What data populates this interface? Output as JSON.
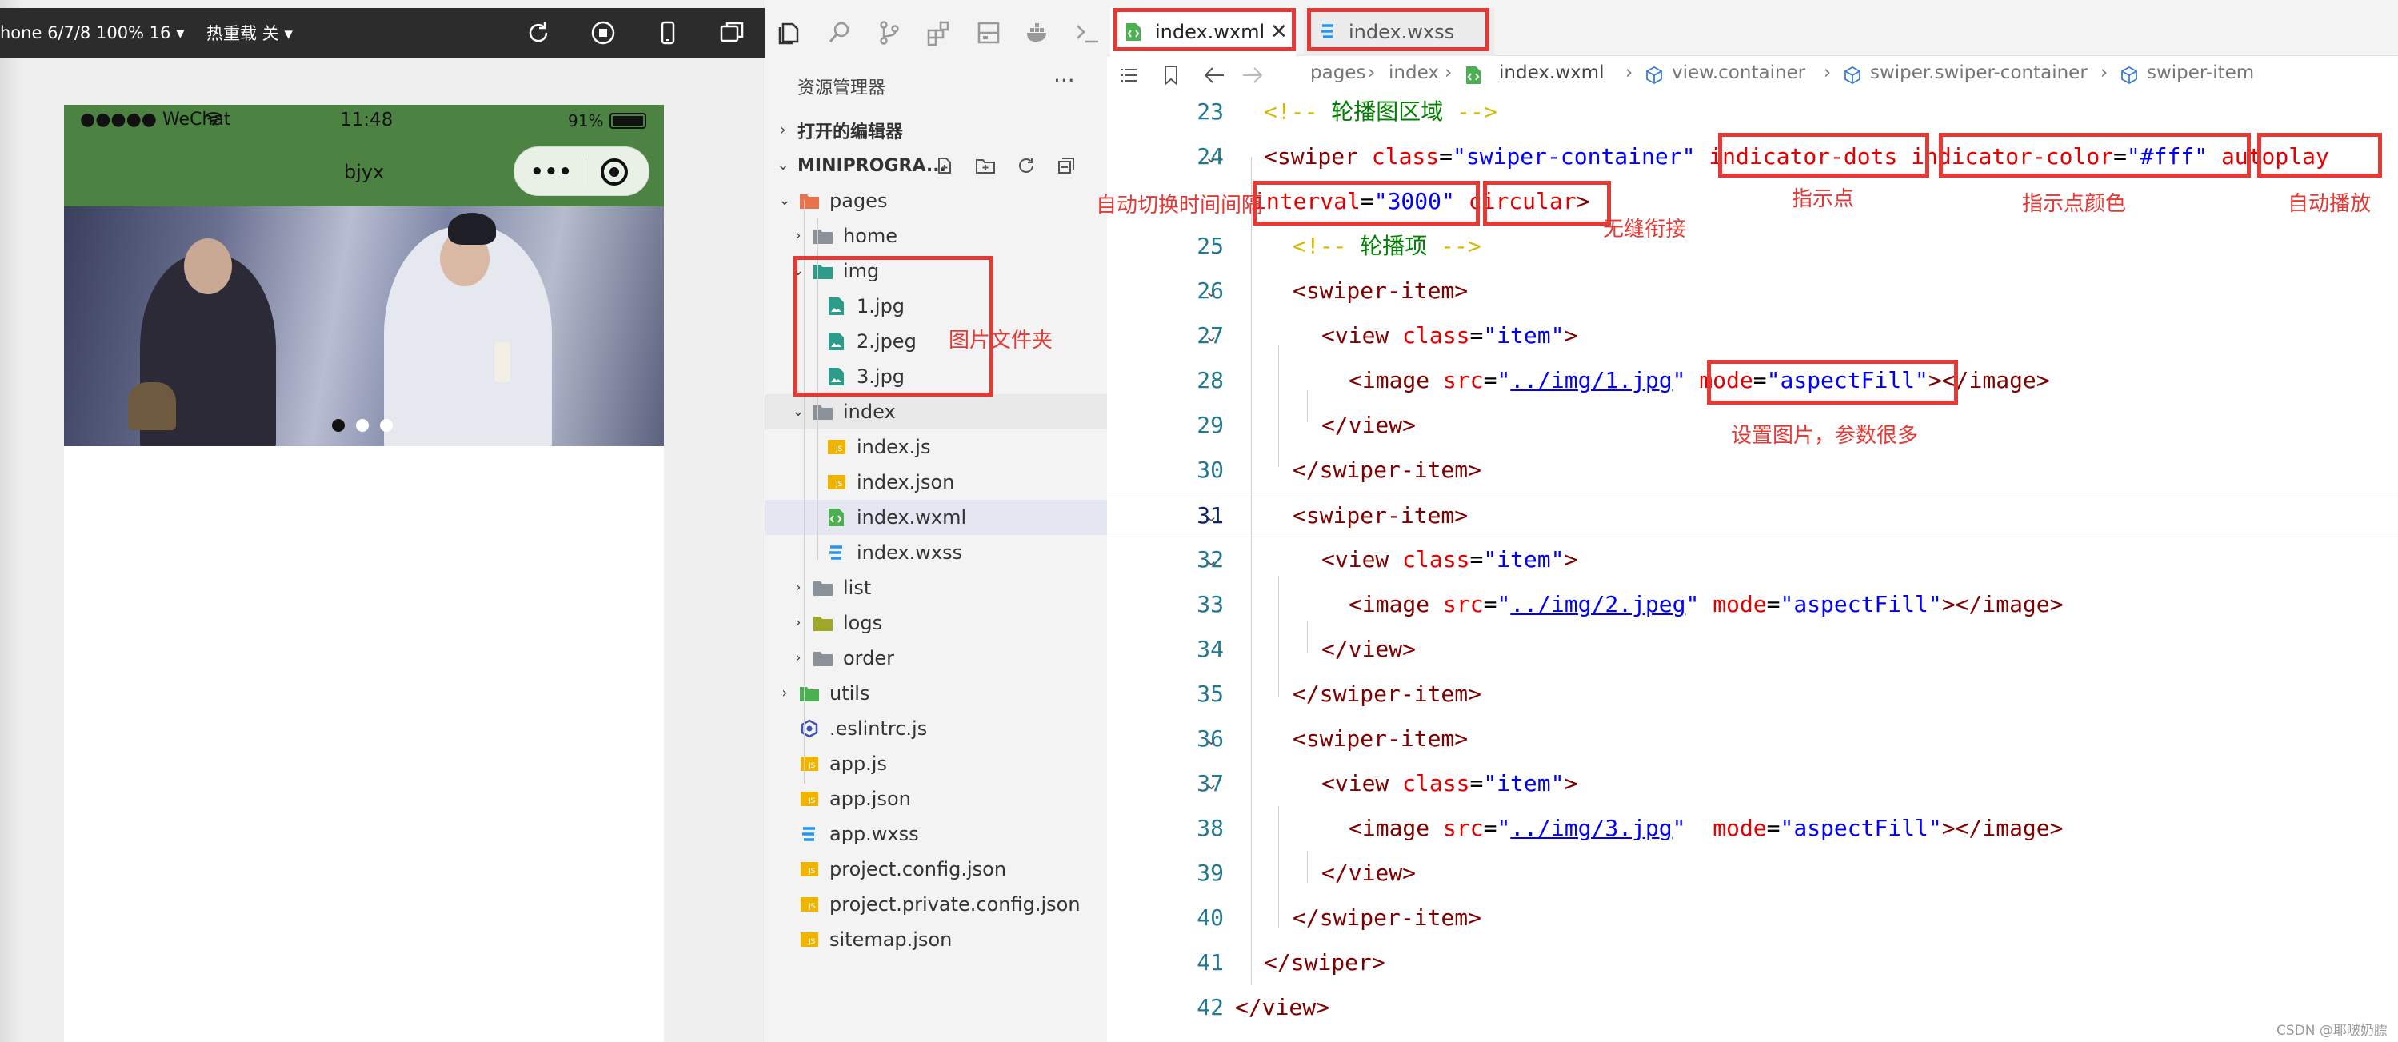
{
  "simulator": {
    "toolbar": {
      "device": "hone 6/7/8 100% 16 ▾",
      "hot_reload": "热重载 关 ▾"
    },
    "statusbar": {
      "carrier": "●●●●● WeChat",
      "time": "11:48",
      "battery": "91%"
    },
    "nav_title": "bjyx",
    "capsule": {
      "menu": "•••"
    },
    "swiper": {
      "dot_count": 3,
      "active_index": 0
    }
  },
  "explorer": {
    "title": "资源管理器",
    "more": "···",
    "open_editors": "打开的编辑器",
    "project": "MINIPROGRA...",
    "items": [
      {
        "label": "pages",
        "icon": "folder-pages-icon",
        "chevron": "open",
        "color": "#e8734a"
      },
      {
        "label": "home",
        "icon": "folder-icon",
        "chevron": "closed",
        "color": "#8b9199"
      },
      {
        "label": "img",
        "icon": "folder-img-icon",
        "chevron": "open",
        "color": "#2e9c8a"
      },
      {
        "label": "1.jpg",
        "icon": "image-file-icon",
        "color": "#2e9c8a"
      },
      {
        "label": "2.jpeg",
        "icon": "image-file-icon",
        "color": "#2e9c8a"
      },
      {
        "label": "3.jpg",
        "icon": "image-file-icon",
        "color": "#2e9c8a"
      },
      {
        "label": "index",
        "icon": "folder-open-icon",
        "chevron": "open",
        "color": "#8b9199"
      },
      {
        "label": "index.js",
        "icon": "js-file-icon",
        "color": "#f0b400"
      },
      {
        "label": "index.json",
        "icon": "json-file-icon",
        "color": "#f0b400"
      },
      {
        "label": "index.wxml",
        "icon": "wxml-file-icon",
        "color": "#4caf50"
      },
      {
        "label": "index.wxss",
        "icon": "css-file-icon",
        "color": "#2196f3"
      },
      {
        "label": "list",
        "icon": "folder-icon",
        "chevron": "closed",
        "color": "#8b9199"
      },
      {
        "label": "logs",
        "icon": "folder-logs-icon",
        "chevron": "closed",
        "color": "#a0a82a"
      },
      {
        "label": "order",
        "icon": "folder-icon",
        "chevron": "closed",
        "color": "#8b9199"
      },
      {
        "label": "utils",
        "icon": "folder-utils-icon",
        "chevron": "closed",
        "color": "#4caf50"
      },
      {
        "label": ".eslintrc.js",
        "icon": "eslint-file-icon",
        "color": "#3f51b5"
      },
      {
        "label": "app.js",
        "icon": "js-file-icon",
        "color": "#f0b400"
      },
      {
        "label": "app.json",
        "icon": "json-file-icon",
        "color": "#f0b400"
      },
      {
        "label": "app.wxss",
        "icon": "css-file-icon",
        "color": "#2196f3"
      },
      {
        "label": "project.config.json",
        "icon": "json-file-icon",
        "color": "#f0b400"
      },
      {
        "label": "project.private.config.json",
        "icon": "json-file-icon",
        "color": "#f0b400"
      },
      {
        "label": "sitemap.json",
        "icon": "json-file-icon",
        "color": "#f0b400"
      }
    ]
  },
  "editor": {
    "tabs": [
      {
        "label": "index.wxml",
        "close": "✕"
      },
      {
        "label": "index.wxss"
      }
    ],
    "breadcrumb": [
      "pages",
      "index",
      "index.wxml",
      "view.container",
      "swiper.swiper-container",
      "swiper-item"
    ],
    "lines": [
      {
        "n": "23",
        "tokens": [
          [
            "bk",
            "<!-- "
          ],
          [
            "cm",
            "轮播图区域"
          ],
          [
            "bk",
            " -->"
          ]
        ]
      },
      {
        "n": "24",
        "fold": true,
        "tokens": [
          [
            "tg",
            "<swiper "
          ],
          [
            "at",
            "class"
          ],
          [
            "pl",
            "="
          ],
          [
            "av",
            "\"swiper-container\""
          ],
          [
            "pl",
            " "
          ],
          [
            "at",
            "indicator-dots"
          ],
          [
            "pl",
            " "
          ],
          [
            "at",
            "indicator-color"
          ],
          [
            "pl",
            "="
          ],
          [
            "av",
            "\"#fff\""
          ],
          [
            "pl",
            " "
          ],
          [
            "at",
            "autoplay"
          ]
        ]
      },
      {
        "n": "",
        "tokens": [
          [
            "at",
            "interval"
          ],
          [
            "pl",
            "="
          ],
          [
            "av",
            "\"3000\""
          ],
          [
            "pl",
            " "
          ],
          [
            "at",
            "circular"
          ],
          [
            "tg",
            ">"
          ]
        ]
      },
      {
        "n": "25",
        "tokens": [
          [
            "bk",
            "<!-- "
          ],
          [
            "cm",
            "轮播项"
          ],
          [
            "bk",
            " -->"
          ]
        ]
      },
      {
        "n": "26",
        "fold": true,
        "tokens": [
          [
            "tg",
            "<swiper-item>"
          ]
        ]
      },
      {
        "n": "27",
        "fold": true,
        "tokens": [
          [
            "tg",
            "<view "
          ],
          [
            "at",
            "class"
          ],
          [
            "pl",
            "="
          ],
          [
            "av",
            "\"item\""
          ],
          [
            "tg",
            ">"
          ]
        ]
      },
      {
        "n": "28",
        "tokens": [
          [
            "tg",
            "<image "
          ],
          [
            "at",
            "src"
          ],
          [
            "pl",
            "="
          ],
          [
            "av",
            "\""
          ],
          [
            "lk",
            "../img/1.jpg"
          ],
          [
            "av",
            "\""
          ],
          [
            "pl",
            " "
          ],
          [
            "at",
            "mode"
          ],
          [
            "pl",
            "="
          ],
          [
            "av",
            "\"aspectFill\""
          ],
          [
            "tg",
            "></image>"
          ]
        ]
      },
      {
        "n": "29",
        "tokens": [
          [
            "tg",
            "</view>"
          ]
        ]
      },
      {
        "n": "30",
        "tokens": [
          [
            "tg",
            "</swiper-item>"
          ]
        ]
      },
      {
        "n": "31",
        "fold": true,
        "active": true,
        "tokens": [
          [
            "tg",
            "<swiper-item>"
          ]
        ]
      },
      {
        "n": "32",
        "fold": true,
        "tokens": [
          [
            "tg",
            "<view "
          ],
          [
            "at",
            "class"
          ],
          [
            "pl",
            "="
          ],
          [
            "av",
            "\"item\""
          ],
          [
            "tg",
            ">"
          ]
        ]
      },
      {
        "n": "33",
        "tokens": [
          [
            "tg",
            "<image "
          ],
          [
            "at",
            "src"
          ],
          [
            "pl",
            "="
          ],
          [
            "av",
            "\""
          ],
          [
            "lk",
            "../img/2.jpeg"
          ],
          [
            "av",
            "\""
          ],
          [
            "pl",
            " "
          ],
          [
            "at",
            "mode"
          ],
          [
            "pl",
            "="
          ],
          [
            "av",
            "\"aspectFill\""
          ],
          [
            "tg",
            "></image>"
          ]
        ]
      },
      {
        "n": "34",
        "tokens": [
          [
            "tg",
            "</view>"
          ]
        ]
      },
      {
        "n": "35",
        "tokens": [
          [
            "tg",
            "</swiper-item>"
          ]
        ]
      },
      {
        "n": "36",
        "fold": true,
        "tokens": [
          [
            "tg",
            "<swiper-item>"
          ]
        ]
      },
      {
        "n": "37",
        "fold": true,
        "tokens": [
          [
            "tg",
            "<view "
          ],
          [
            "at",
            "class"
          ],
          [
            "pl",
            "="
          ],
          [
            "av",
            "\"item\""
          ],
          [
            "tg",
            ">"
          ]
        ]
      },
      {
        "n": "38",
        "tokens": [
          [
            "tg",
            "<image "
          ],
          [
            "at",
            "src"
          ],
          [
            "pl",
            "="
          ],
          [
            "av",
            "\""
          ],
          [
            "lk",
            "../img/3.jpg"
          ],
          [
            "av",
            "\""
          ],
          [
            "pl",
            "  "
          ],
          [
            "at",
            "mode"
          ],
          [
            "pl",
            "="
          ],
          [
            "av",
            "\"aspectFill\""
          ],
          [
            "tg",
            "></image>"
          ]
        ]
      },
      {
        "n": "39",
        "tokens": [
          [
            "tg",
            "</view>"
          ]
        ]
      },
      {
        "n": "40",
        "tokens": [
          [
            "tg",
            "</swiper-item>"
          ]
        ]
      },
      {
        "n": "41",
        "tokens": [
          [
            "tg",
            "</swiper>"
          ]
        ]
      },
      {
        "n": "42",
        "tokens": [
          [
            "tg",
            "</view>"
          ]
        ]
      }
    ]
  },
  "annotations": {
    "img_folder": "图片文件夹",
    "interval": "自动切换时间间隔",
    "circular": "无缝衔接",
    "indicator_dots": "指示点",
    "indicator_color": "指示点颜色",
    "autoplay": "自动播放",
    "mode": "设置图片，参数很多"
  },
  "watermark": "CSDN @耶啵奶膘",
  "colors": {
    "accent_red": "#e53935",
    "nav_green": "#4c8342"
  }
}
